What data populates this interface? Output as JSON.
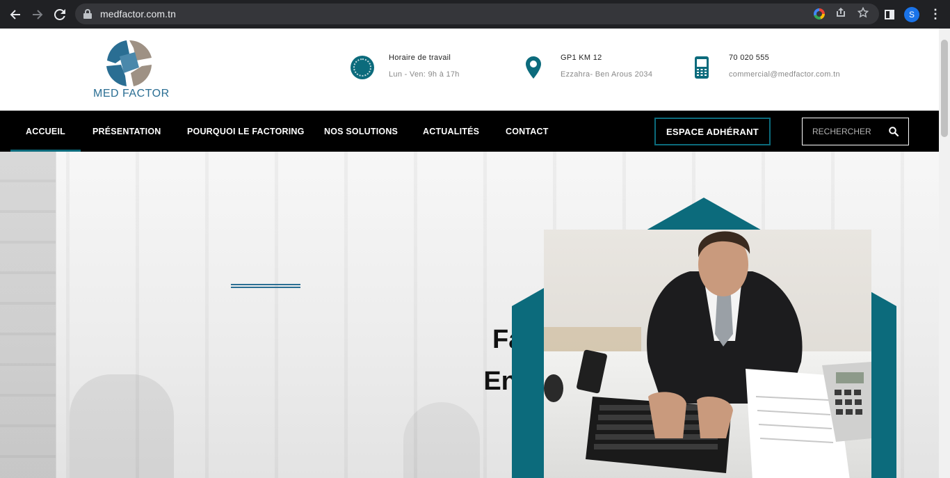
{
  "browser": {
    "url": "medfactor.com.tn",
    "profile_initial": "S"
  },
  "logo": {
    "word1": "MED",
    "word2": "FACTOR"
  },
  "contact_info": {
    "hours": {
      "title": "Horaire de travail",
      "detail": "Lun - Ven: 9h à 17h",
      "icon": "clock-icon"
    },
    "address": {
      "title": "GP1 KM 12",
      "detail": "Ezzahra- Ben Arous 2034",
      "icon": "location-pin-icon"
    },
    "phone": {
      "title": "70 020 555",
      "detail": "commercial@medfactor.com.tn",
      "icon": "mobile-phone-icon"
    }
  },
  "nav": {
    "items": [
      {
        "label": "ACCUEIL",
        "active": true
      },
      {
        "label": "PRÉSENTATION",
        "active": false
      },
      {
        "label": "POURQUOI LE FACTORING",
        "active": false
      },
      {
        "label": "NOS SOLUTIONS",
        "active": false
      },
      {
        "label": "ACTUALITÉS",
        "active": false
      },
      {
        "label": "CONTACT",
        "active": false
      }
    ],
    "cta_label": "ESPACE ADHÉRANT",
    "search_placeholder": "RECHERCHER"
  },
  "hero": {
    "title_line1": "Fact",
    "title_line2": "Enca"
  },
  "colors": {
    "brand_teal": "#0c6b7c",
    "brand_blue": "#2a6e93",
    "brand_taupe": "#9e9184",
    "nav_bg": "#000000"
  }
}
